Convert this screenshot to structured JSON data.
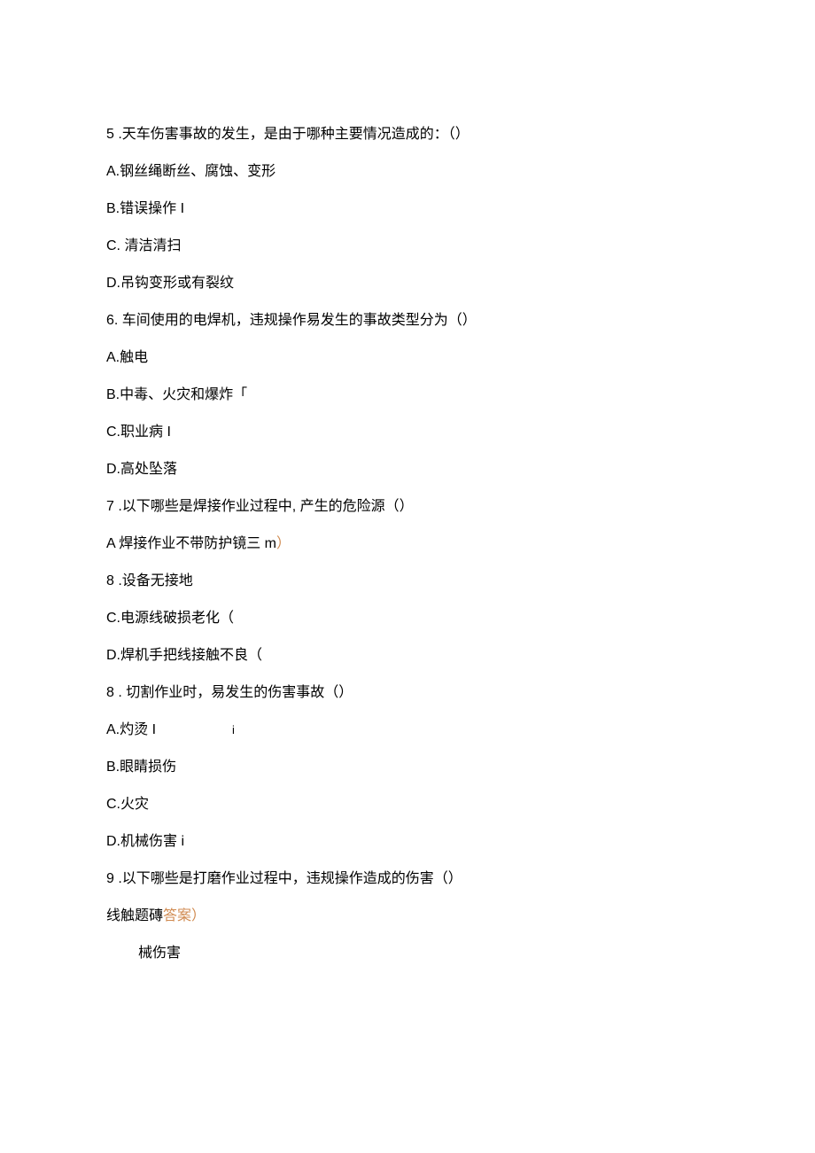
{
  "q5": {
    "text": "5 .天车伤害事故的发生，是由于哪种主要情况造成的：（）",
    "a": "A.钢丝绳断丝、腐蚀、变形",
    "b": "B.错误操作 I",
    "c": "C. 清洁清扫",
    "d": "D.吊钩变形或有裂纹"
  },
  "q6": {
    "text": "6. 车间使用的电焊机，违规操作易发生的事故类型分为（）",
    "a": "A.触电",
    "b": "B.中毒、火灾和爆炸「",
    "c": "C.职业病 I",
    "d": "D.高处坠落"
  },
  "q7": {
    "text": "7  .以下哪些是焊接作业过程中, 产生的危险源（）",
    "a_pre": "A 焊接作业不带防护镜三 m",
    "a_suf": "）",
    "b": "8  .设备无接地",
    "c": "C.电源线破损老化（",
    "d": "D.焊机手把线接触不良（"
  },
  "q8": {
    "text": "8  . 切割作业时，易发生的伤害事故（）",
    "a": "A.灼烫 I",
    "a_tail": "i",
    "b": "B.眼睛损伤",
    "c": "C.火灾",
    "d": "D.机械伤害 i"
  },
  "q9": {
    "text": "9  .以下哪些是打磨作业过程中，违规操作造成的伤害（）",
    "line1_pre": "线触题磚",
    "line1_ans": "答案）",
    "line2": "械伤害"
  }
}
